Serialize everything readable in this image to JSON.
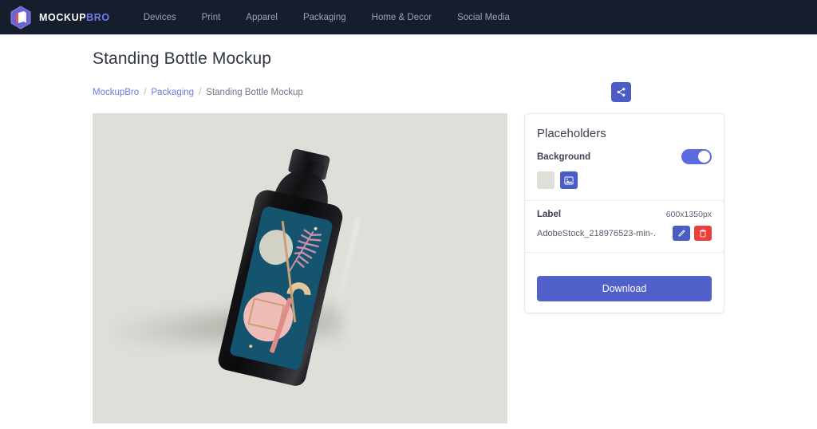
{
  "navbar": {
    "brand_primary": "MOCKUP",
    "brand_accent": "BRO",
    "logo_icon": "hexagon-logo-icon",
    "links": [
      {
        "label": "Devices"
      },
      {
        "label": "Print"
      },
      {
        "label": "Apparel"
      },
      {
        "label": "Packaging"
      },
      {
        "label": "Home & Decor"
      },
      {
        "label": "Social Media"
      }
    ]
  },
  "page": {
    "title": "Standing Bottle Mockup",
    "breadcrumb": {
      "root": "MockupBro",
      "sep1": "/",
      "category": "Packaging",
      "sep2": "/",
      "current": "Standing Bottle Mockup"
    },
    "share_icon": "share-icon"
  },
  "mockup": {
    "canvas_background": "#dedfd8",
    "product": "standing-bottle",
    "bottle_color": "#111114",
    "label_background": "#14546f",
    "label_accents": [
      "#f0bcb8",
      "#e6dfcf",
      "#e3c79a",
      "#c9a078",
      "#e08a8a"
    ]
  },
  "panel": {
    "title": "Placeholders",
    "background": {
      "label": "Background",
      "toggle_on": true,
      "swatches": [
        {
          "name": "color-swatch",
          "color": "#dedfd8",
          "selected": false
        },
        {
          "name": "image-swatch",
          "color": "#4c5cc5",
          "selected": true,
          "icon": "image-icon"
        }
      ]
    },
    "label_section": {
      "label": "Label",
      "dimensions": "600x1350px",
      "file_name": "AdobeStock_218976523-min-…",
      "edit_icon": "pencil-icon",
      "delete_icon": "trash-icon"
    },
    "download_label": "Download"
  }
}
